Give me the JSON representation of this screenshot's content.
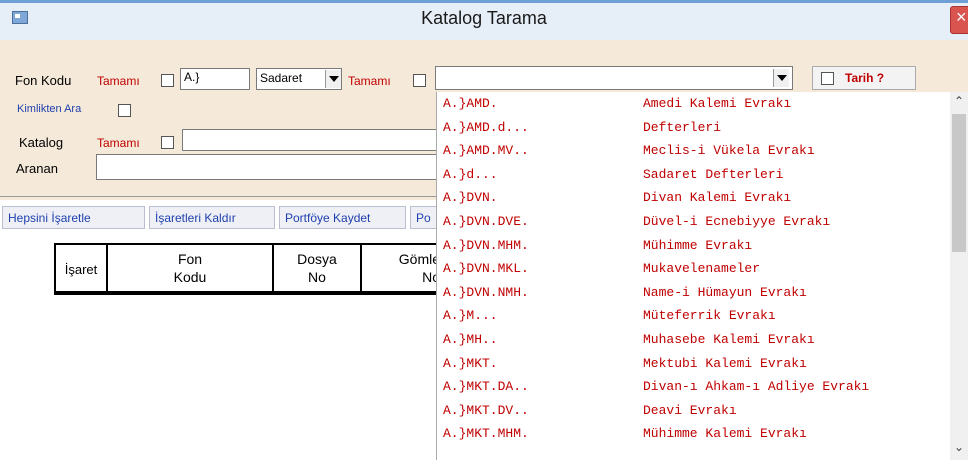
{
  "window": {
    "title": "Katalog Tarama"
  },
  "filters": {
    "fon_kodu_label": "Fon Kodu",
    "tamami_label": "Tamamı",
    "fon_kodu_value": "A.}",
    "sadaret_value": "Sadaret",
    "tamami2_label": "Tamamı",
    "tarih_label": "Tarih ?",
    "kimlikten_ara_label": "Kimlikten Ara",
    "katalog_label": "Katalog",
    "katalog_tamami_label": "Tamamı",
    "aranan_label": "Aranan"
  },
  "toolbar": {
    "mark_all": "Hepsini İşaretle",
    "unmark": "İşaretleri Kaldır",
    "save_portfolio": "Portföye Kaydet",
    "truncated": "Po"
  },
  "grid": {
    "columns": [
      {
        "line1": "İşaret",
        "line2": ""
      },
      {
        "line1": "Fon",
        "line2": "Kodu"
      },
      {
        "line1": "Dosya",
        "line2": "No"
      },
      {
        "line1": "Gömle",
        "line2": "No"
      }
    ]
  },
  "dropdown": {
    "items": [
      {
        "code": "A.}AMD.",
        "name": "Amedi Kalemi Evrakı"
      },
      {
        "code": "A.}AMD.d...",
        "name": "Defterleri"
      },
      {
        "code": "A.}AMD.MV..",
        "name": "Meclis-i Vükela Evrakı"
      },
      {
        "code": "A.}d...",
        "name": "Sadaret Defterleri"
      },
      {
        "code": "A.}DVN.",
        "name": "Divan Kalemi Evrakı"
      },
      {
        "code": "A.}DVN.DVE.",
        "name": "Düvel-i Ecnebiyye Evrakı"
      },
      {
        "code": "A.}DVN.MHM.",
        "name": "Mühimme Evrakı"
      },
      {
        "code": "A.}DVN.MKL.",
        "name": "Mukavelenameler"
      },
      {
        "code": "A.}DVN.NMH.",
        "name": "Name-i Hümayun Evrakı"
      },
      {
        "code": "A.}M...",
        "name": "Müteferrik Evrakı"
      },
      {
        "code": "A.}MH..",
        "name": "Muhasebe Kalemi Evrakı"
      },
      {
        "code": "A.}MKT.",
        "name": "Mektubi Kalemi Evrakı"
      },
      {
        "code": "A.}MKT.DA..",
        "name": "Divan-ı Ahkam-ı Adliye Evrakı"
      },
      {
        "code": "A.}MKT.DV..",
        "name": "Deavi Evrakı"
      },
      {
        "code": "A.}MKT.MHM.",
        "name": "Mühimme Kalemi Evrakı"
      }
    ]
  },
  "icons": {
    "app": "app-window-icon",
    "close": "close-icon",
    "dropdown": "chevron-down-icon",
    "scroll_up": "chevron-up-icon",
    "scroll_down": "chevron-down-icon"
  }
}
